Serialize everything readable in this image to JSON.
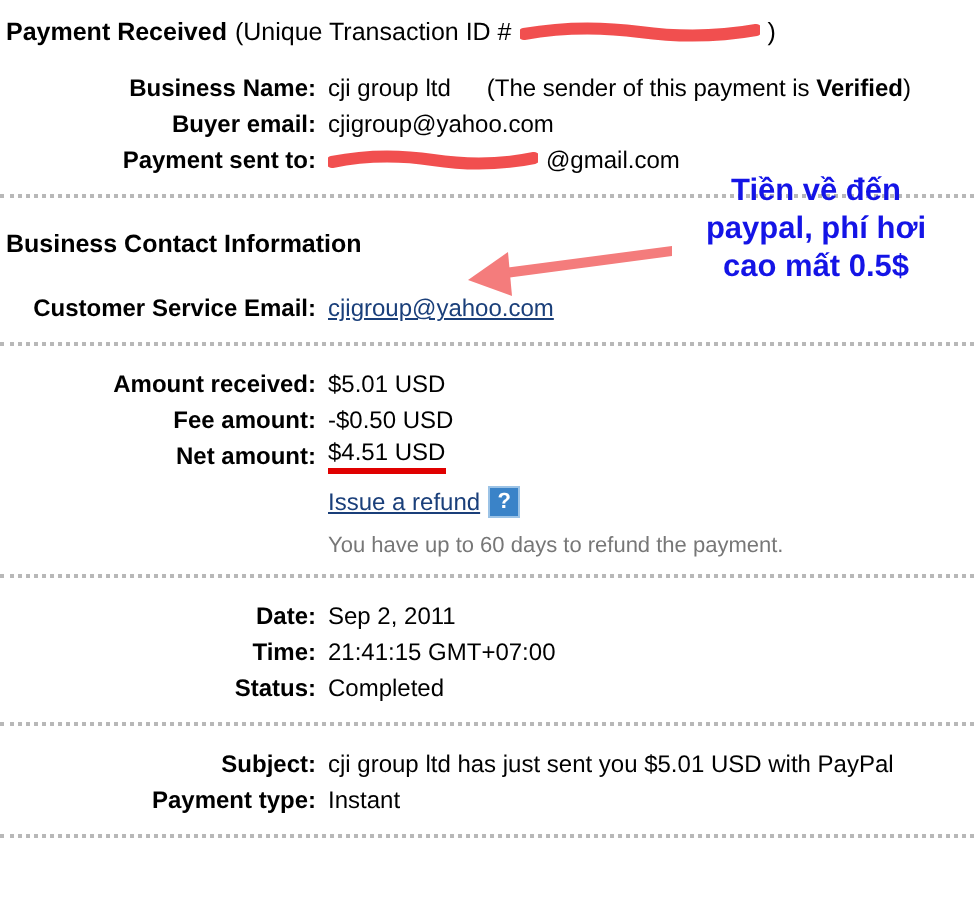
{
  "header": {
    "title": "Payment Received",
    "id_label": "(Unique Transaction ID #",
    "id_close": ")"
  },
  "sections": [
    {
      "rows": [
        {
          "kind": "text",
          "label": "Business Name:",
          "value": "cji group ltd",
          "note": "(The sender of this payment is **Verified**)"
        },
        {
          "kind": "text",
          "label": "Buyer email:",
          "value": "cjigroup@yahoo.com"
        },
        {
          "kind": "redacted",
          "label": "Payment sent to:",
          "value": "@gmail.com"
        }
      ]
    },
    {
      "heading": "Business Contact Information",
      "rows": [
        {
          "kind": "link",
          "label": "Customer Service Email:",
          "value": "cjigroup@yahoo.com"
        }
      ]
    },
    {
      "rows": [
        {
          "kind": "text",
          "label": "Amount received:",
          "value": "$5.01 USD"
        },
        {
          "kind": "text",
          "label": "Fee amount:",
          "value": "-$0.50 USD"
        },
        {
          "kind": "text",
          "label": "Net amount:",
          "value": "$4.51 USD",
          "marked": true
        }
      ],
      "refund": {
        "link": "Issue a refund",
        "help": "?",
        "note": "You have up to 60 days to refund the payment."
      }
    },
    {
      "rows": [
        {
          "kind": "text",
          "label": "Date:",
          "value": "Sep 2, 2011"
        },
        {
          "kind": "text",
          "label": "Time:",
          "value": "21:41:15 GMT+07:00"
        },
        {
          "kind": "text",
          "label": "Status:",
          "value": "Completed"
        }
      ]
    },
    {
      "rows": [
        {
          "kind": "text",
          "label": "Subject:",
          "value": "cji group ltd has just sent you $5.01 USD with PayPal"
        },
        {
          "kind": "text",
          "label": "Payment type:",
          "value": "Instant"
        }
      ]
    }
  ],
  "annotation": {
    "lines": [
      "Tiền về đến",
      "paypal, phí hơi",
      "cao mất 0.5$"
    ]
  }
}
